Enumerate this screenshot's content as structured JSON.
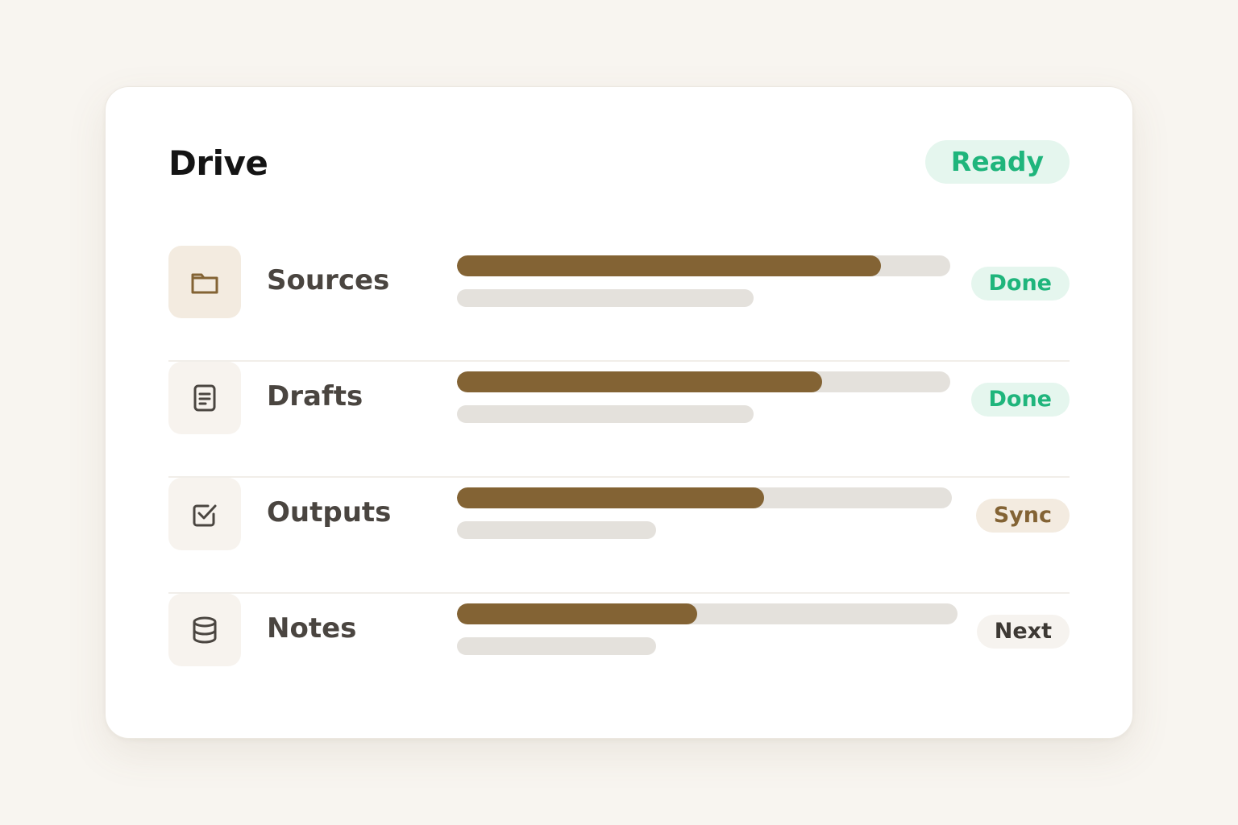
{
  "app": {
    "title": "Drive",
    "status": "Ready"
  },
  "rows": [
    {
      "label": "Sources",
      "icon": "folder-icon",
      "progress": 0.86,
      "status": "Done",
      "status_kind": "done"
    },
    {
      "label": "Drafts",
      "icon": "document-icon",
      "progress": 0.74,
      "status": "Done",
      "status_kind": "done"
    },
    {
      "label": "Outputs",
      "icon": "checkbox-icon",
      "progress": 0.62,
      "status": "Sync",
      "status_kind": "sync"
    },
    {
      "label": "Notes",
      "icon": "database-icon",
      "progress": 0.48,
      "status": "Next",
      "status_kind": "next"
    }
  ],
  "colors": {
    "accent": "#836334",
    "track": "#e4e1dc",
    "success": "#1fb57c",
    "success_bg": "#e5f6ee",
    "sync_bg": "#f3ebe0",
    "background": "#f8f5f0"
  }
}
